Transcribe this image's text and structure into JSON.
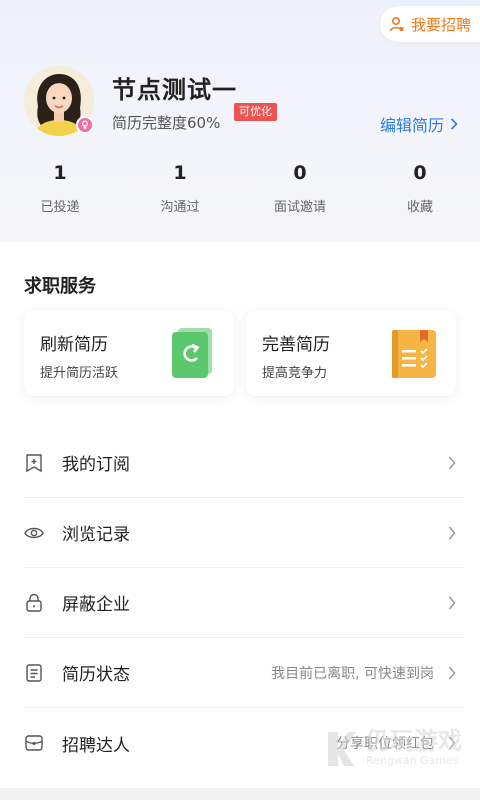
{
  "header": {
    "recruit_label": "我要招聘",
    "name": "节点测试一",
    "completeness": "简历完整度60%",
    "optimize_tag": "可优化",
    "edit_resume": "编辑简历"
  },
  "stats": [
    {
      "value": "1",
      "label": "已投递"
    },
    {
      "value": "1",
      "label": "沟通过"
    },
    {
      "value": "0",
      "label": "面试邀请"
    },
    {
      "value": "0",
      "label": "收藏"
    }
  ],
  "services": {
    "title": "求职服务",
    "cards": [
      {
        "title": "刷新简历",
        "subtitle": "提升简历活跃",
        "icon": "refresh-icon",
        "color": "#5cc86e"
      },
      {
        "title": "完善简历",
        "subtitle": "提高竞争力",
        "icon": "resume-book-icon",
        "color": "#f5b443"
      }
    ]
  },
  "menu": [
    {
      "label": "我的订阅",
      "value": "",
      "icon": "bookmark-icon"
    },
    {
      "label": "浏览记录",
      "value": "",
      "icon": "eye-icon"
    },
    {
      "label": "屏蔽企业",
      "value": "",
      "icon": "lock-icon"
    },
    {
      "label": "简历状态",
      "value": "我目前已离职, 可快速到岗",
      "icon": "document-icon"
    },
    {
      "label": "招聘达人",
      "value": "分享职位领红包",
      "icon": "wallet-icon"
    }
  ],
  "watermark": {
    "cn": "仍玩游戏",
    "en": "Rengwan Games"
  },
  "colors": {
    "accent": "#2f7ae5",
    "orange": "#f07a1a",
    "tag": "#ef5350"
  }
}
